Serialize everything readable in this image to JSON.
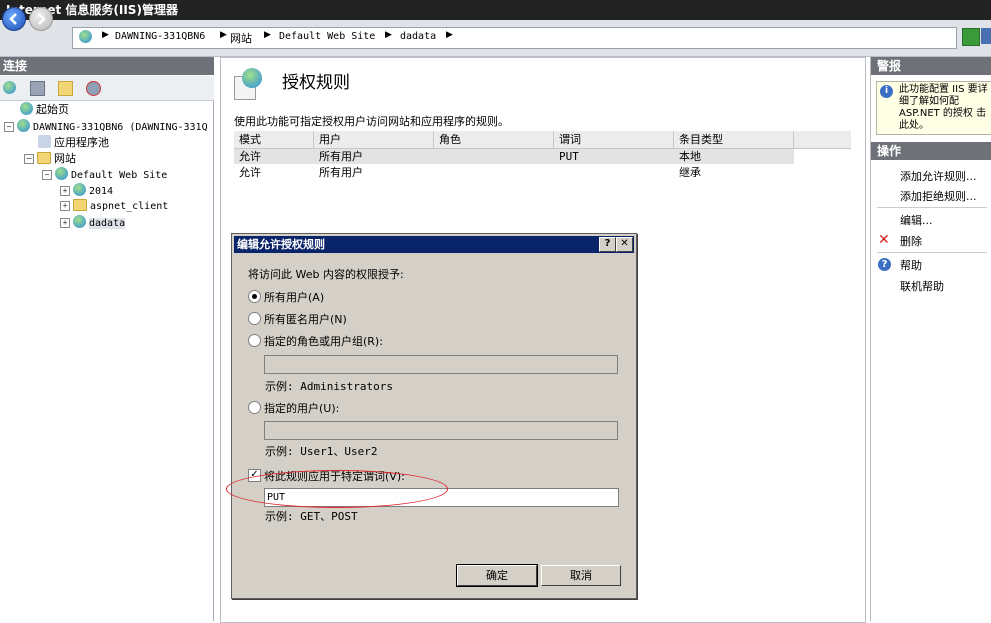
{
  "window": {
    "title": "Internet 信息服务(IIS)管理器"
  },
  "breadcrumb": [
    "DAWNING-331QBN6",
    "网站",
    "Default Web Site",
    "dadata"
  ],
  "left_pane": {
    "header": "连接",
    "tree": {
      "start_page": "起始页",
      "server": "DAWNING-331QBN6 (DAWNING-331Q",
      "app_pools": "应用程序池",
      "sites": "网站",
      "default_site": "Default Web Site",
      "children": [
        "2014",
        "aspnet_client",
        "dadata"
      ]
    }
  },
  "center": {
    "title": "授权规则",
    "description": "使用此功能可指定授权用户访问网站和应用程序的规则。",
    "columns": [
      "模式",
      "用户",
      "角色",
      "谓词",
      "条目类型"
    ],
    "rows": [
      {
        "mode": "允许",
        "user": "所有用户",
        "role": "",
        "verb": "PUT",
        "entry_type": "本地"
      },
      {
        "mode": "允许",
        "user": "所有用户",
        "role": "",
        "verb": "",
        "entry_type": "继承"
      }
    ]
  },
  "dialog": {
    "title": "编辑允许授权规则",
    "help_btn": "?",
    "close_btn": "✕",
    "prompt": "将访问此 Web 内容的权限授予:",
    "option_all_users": "所有用户(A)",
    "option_anonymous": "所有匿名用户(N)",
    "option_roles": "指定的角色或用户组(R):",
    "roles_value": "",
    "roles_example": "示例: Administrators",
    "option_users": "指定的用户(U):",
    "users_value": "",
    "users_example": "示例: User1、User2",
    "verbs_label": "将此规则应用于特定谓词(V):",
    "verbs_value": "PUT",
    "verbs_example": "示例: GET、POST",
    "ok": "确定",
    "cancel": "取消"
  },
  "right_pane": {
    "alerts_header": "警报",
    "alert_text": "此功能配置 IIS 要详细了解如何配 ASP.NET 的授权 击此处。",
    "actions_header": "操作",
    "actions": [
      "添加允许规则...",
      "添加拒绝规则...",
      "编辑...",
      "删除",
      "帮助",
      "联机帮助"
    ]
  }
}
